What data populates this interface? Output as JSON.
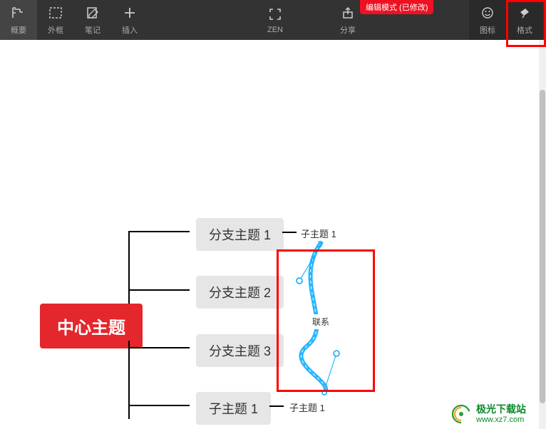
{
  "toolbar": {
    "left": [
      {
        "name": "overview",
        "label": "概要"
      },
      {
        "name": "outline",
        "label": "外框"
      },
      {
        "name": "note",
        "label": "笔记"
      },
      {
        "name": "insert",
        "label": "插入"
      }
    ],
    "center": [
      {
        "name": "zen",
        "label": "ZEN"
      },
      {
        "name": "share",
        "label": "分享"
      }
    ],
    "right": [
      {
        "name": "icon",
        "label": "图标"
      },
      {
        "name": "format",
        "label": "格式"
      }
    ],
    "tag": "编辑模式 (已修改)"
  },
  "mindmap": {
    "center": "中心主题",
    "branches": [
      "分支主题 1",
      "分支主题 2",
      "分支主题 3",
      "子主题 1"
    ],
    "subs": [
      "子主题 1",
      "子主题 1"
    ],
    "relationship": "联系"
  },
  "watermark": {
    "title": "极光下载站",
    "url": "www.xz7.com"
  }
}
